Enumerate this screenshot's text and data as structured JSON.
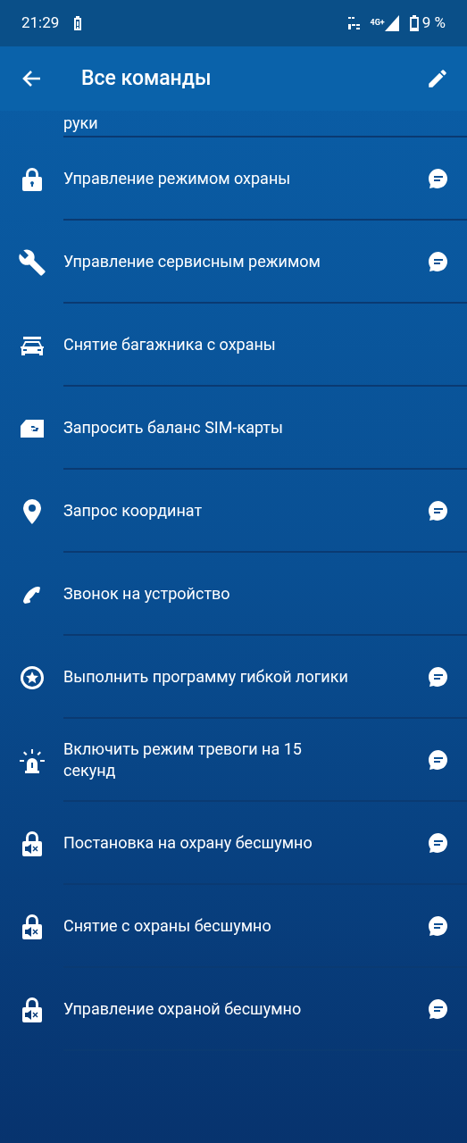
{
  "status_bar": {
    "time": "21:29",
    "network": "4G+",
    "battery": "9 %"
  },
  "header": {
    "title": "Все команды"
  },
  "partial_item": {
    "label": "руки"
  },
  "commands": [
    {
      "label": "Управление режимом охраны",
      "sms": true
    },
    {
      "label": "Управление сервисным режимом",
      "sms": true
    },
    {
      "label": "Снятие багажника с охраны",
      "sms": false
    },
    {
      "label": "Запросить баланс SIM-карты",
      "sms": false
    },
    {
      "label": "Запрос координат",
      "sms": true
    },
    {
      "label": "Звонок на устройство",
      "sms": false
    },
    {
      "label": "Выполнить программу гибкой логики",
      "sms": true
    },
    {
      "label": "Включить режим тревоги на 15 секунд",
      "sms": true
    },
    {
      "label": "Постановка на охрану бесшумно",
      "sms": true
    },
    {
      "label": "Снятие с охраны бесшумно",
      "sms": true
    },
    {
      "label": "Управление охраной бесшумно",
      "sms": true
    }
  ]
}
